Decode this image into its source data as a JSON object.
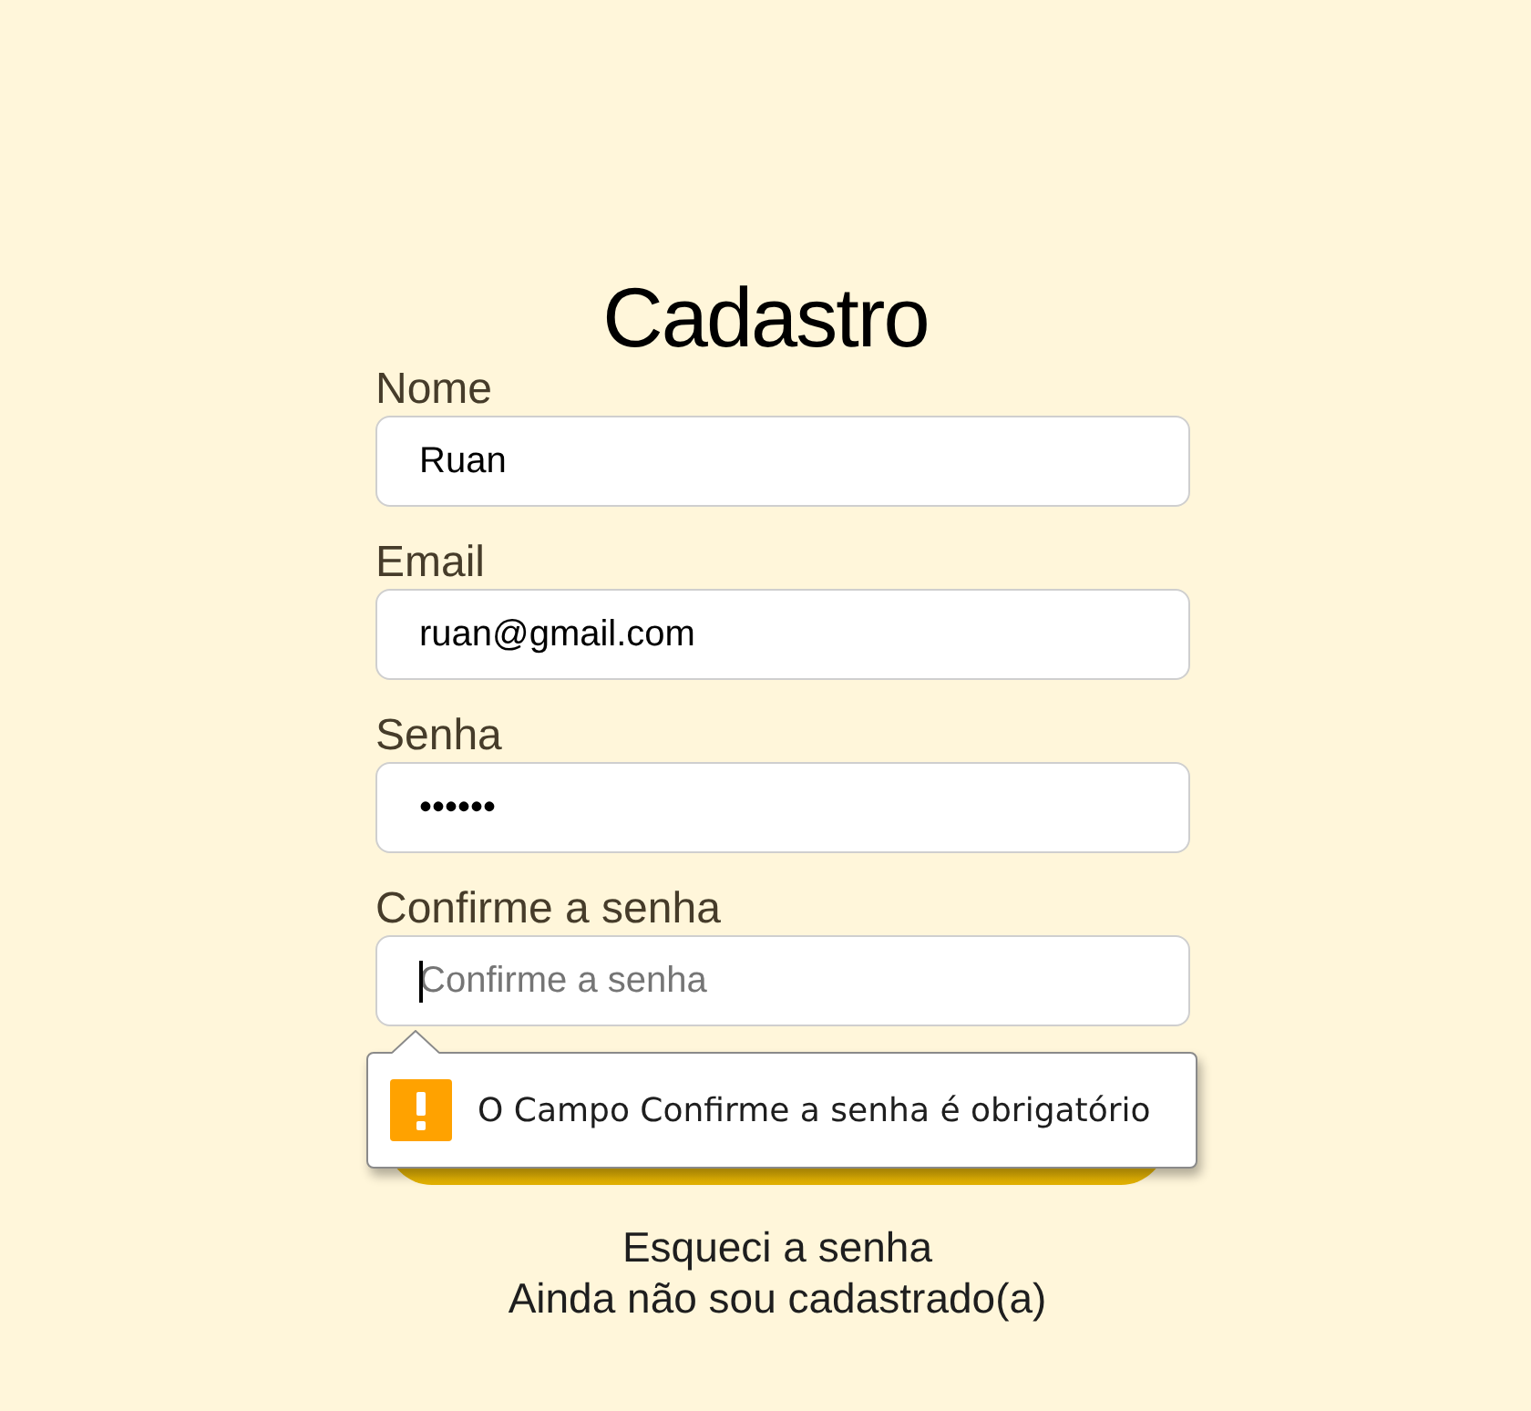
{
  "title": "Cadastro",
  "fields": [
    {
      "label": "Nome",
      "value": "Ruan",
      "focused": false
    },
    {
      "label": "Email",
      "value": "ruan@gmail.com",
      "focused": false
    },
    {
      "label": "Senha",
      "value": "••••••",
      "focused": false
    },
    {
      "label": "Confirme a senha",
      "placeholder": "Confirme a senha",
      "focused": true,
      "error": "O Campo Confirme a senha é obrigatório"
    }
  ],
  "links": [
    "Esqueci a senha",
    "Ainda não sou cadastrado(a)"
  ]
}
